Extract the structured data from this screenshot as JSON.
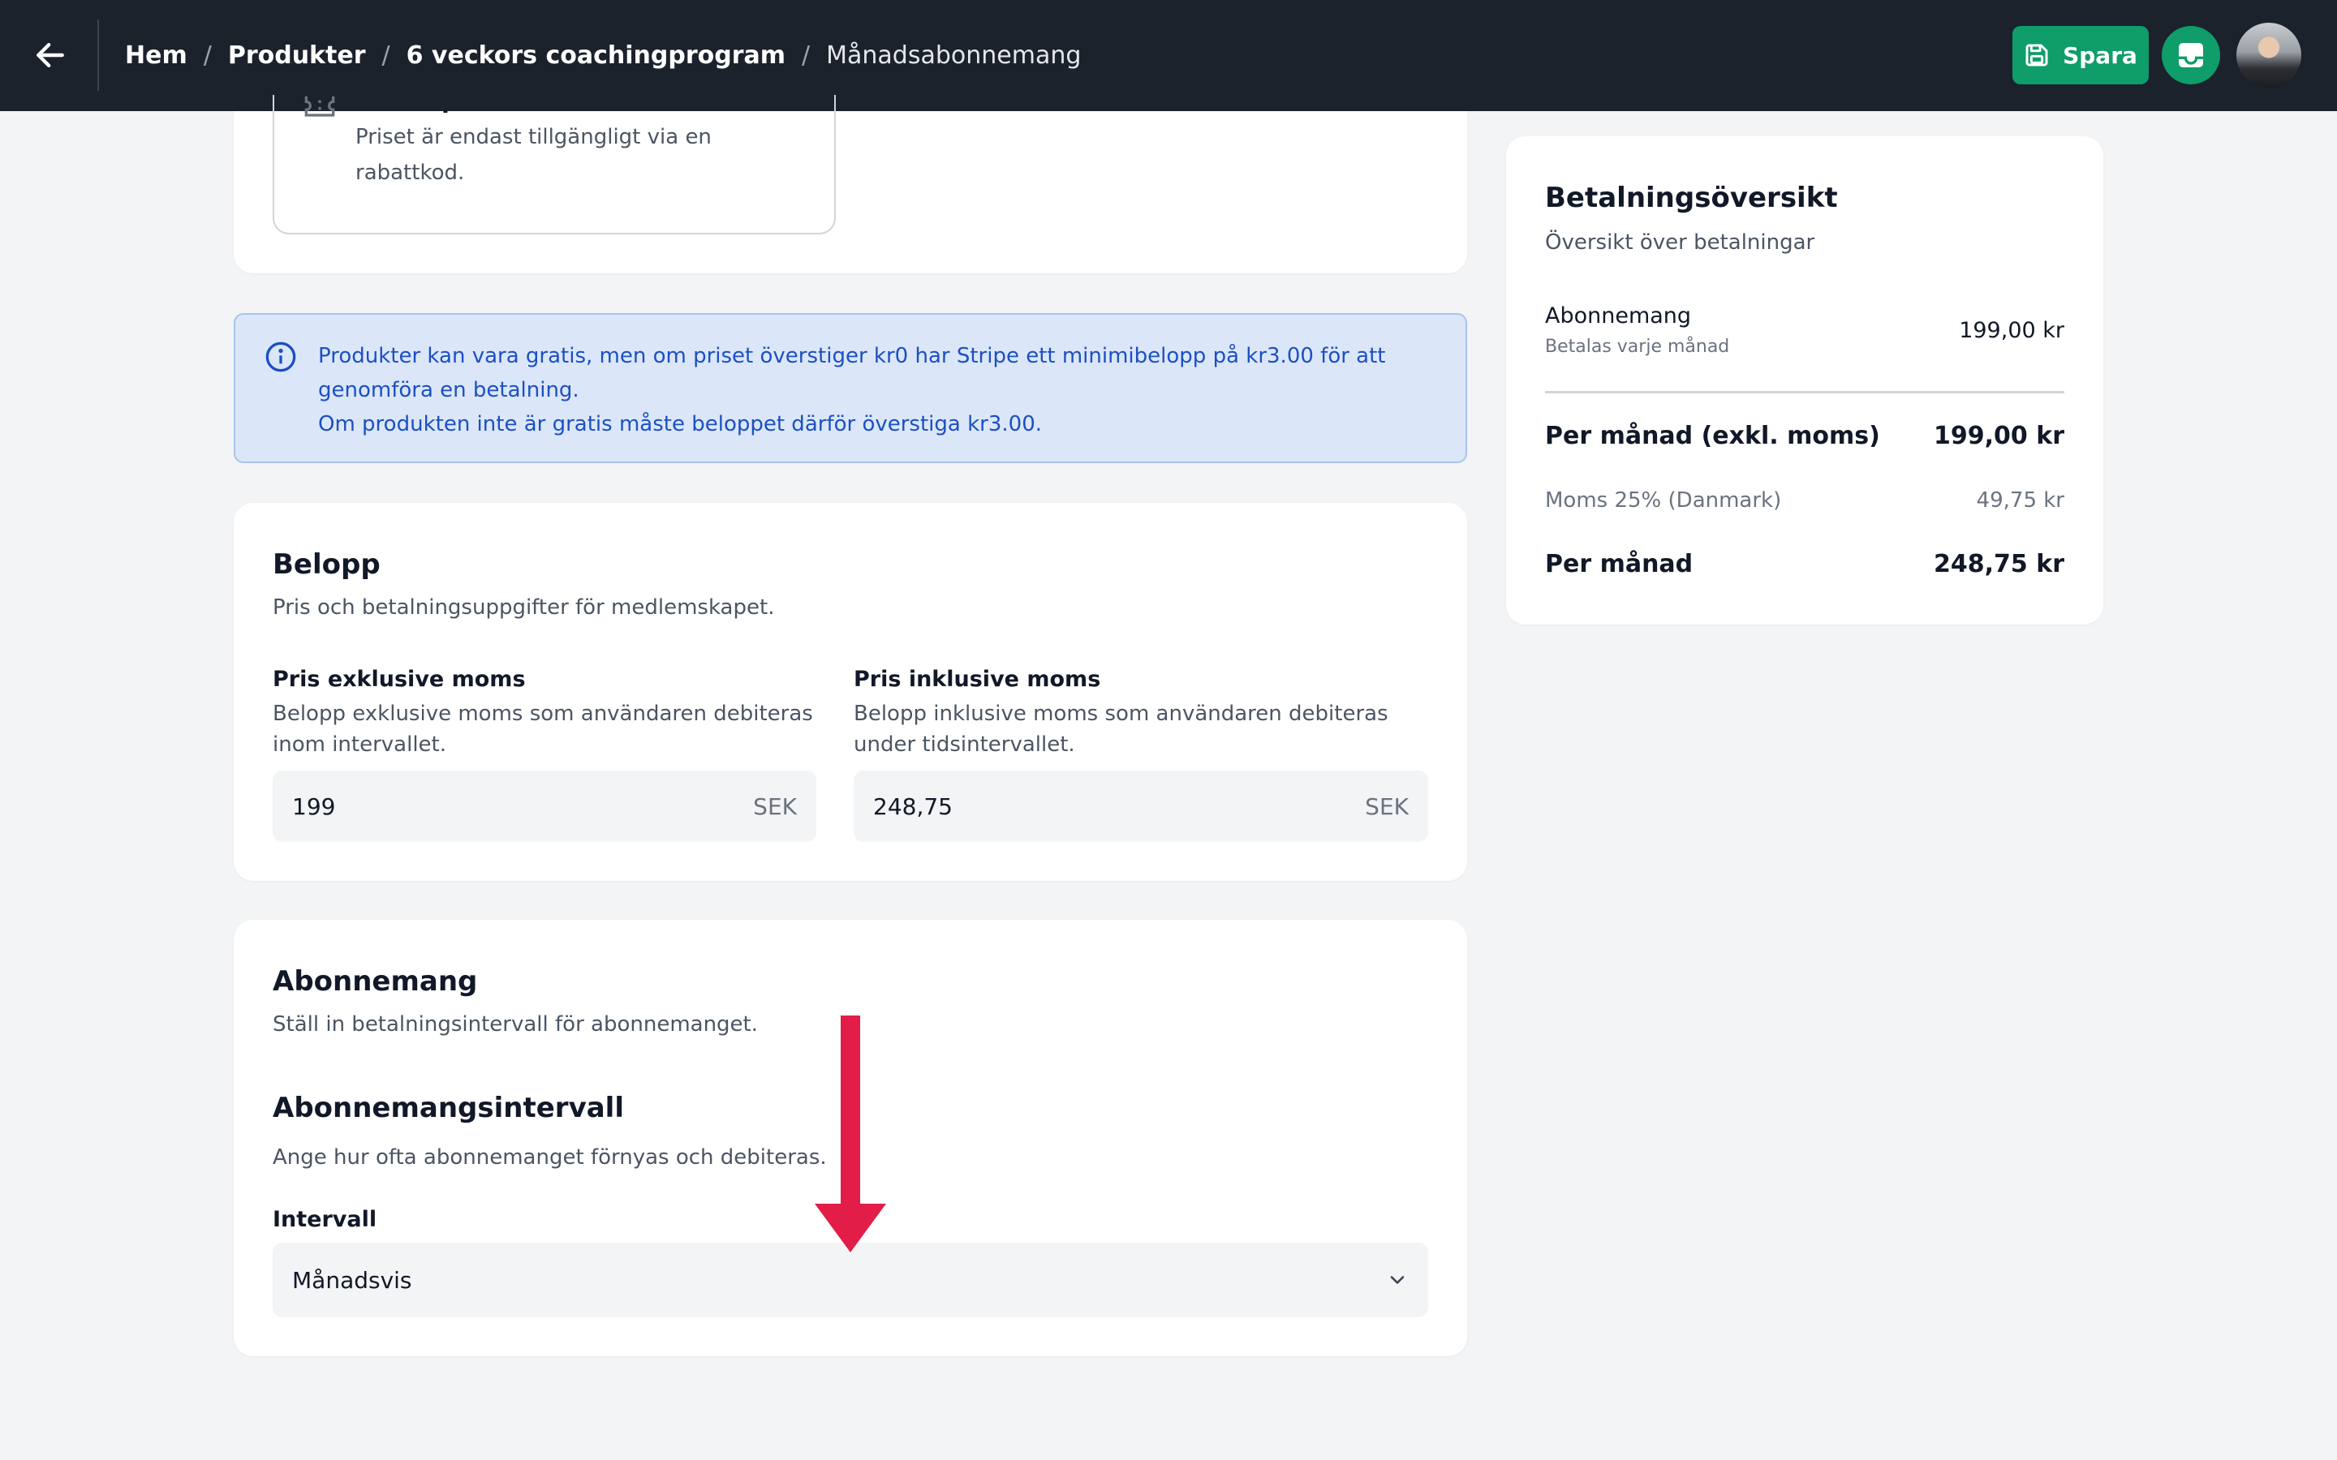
{
  "header": {
    "breadcrumb": {
      "home": "Hem",
      "products": "Produkter",
      "program": "6 veckors coachingprogram",
      "current": "Månadsabonnemang",
      "separator": "/"
    },
    "save_label": "Spara"
  },
  "rabatt_option": {
    "title": "Rabattpris",
    "description": "Priset är endast tillgängligt via en rabattkod."
  },
  "alert": {
    "line1": "Produkter kan vara gratis, men om priset överstiger kr0 har Stripe ett minimibelopp på kr3.00 för att genomföra en betalning.",
    "line2": "Om produkten inte är gratis måste beloppet därför överstiga kr3.00."
  },
  "belopp": {
    "title": "Belopp",
    "subtitle": "Pris och betalningsuppgifter för medlemskapet.",
    "excl": {
      "label": "Pris exklusive moms",
      "help": "Belopp exklusive moms som användaren debiteras inom intervallet.",
      "value": "199",
      "currency": "SEK"
    },
    "incl": {
      "label": "Pris inklusive moms",
      "help": "Belopp inklusive moms som användaren debiteras under tidsintervallet.",
      "value": "248,75",
      "currency": "SEK"
    }
  },
  "abonnemang": {
    "title": "Abonnemang",
    "subtitle": "Ställ in betalningsintervall för abonnemanget.",
    "interval_title": "Abonnemangsintervall",
    "interval_subtitle": "Ange hur ofta abonnemanget förnyas och debiteras.",
    "interval_label": "Intervall",
    "interval_value": "Månadsvis"
  },
  "payment_overview": {
    "title": "Betalningsöversikt",
    "subtitle": "Översikt över betalningar",
    "item_label": "Abonnemang",
    "item_sub": "Betalas varje månad",
    "item_value": "199,00 kr",
    "per_month_excl_label": "Per månad (exkl. moms)",
    "per_month_excl_value": "199,00 kr",
    "vat_label": "Moms 25% (Danmark)",
    "vat_value": "49,75 kr",
    "per_month_label": "Per månad",
    "per_month_value": "248,75 kr"
  },
  "colors": {
    "topbar": "#1b222c",
    "accent_green": "#0f9d6a",
    "info_blue": "#1d4fc4",
    "annotation_red": "#e11d48"
  },
  "icons": {
    "back": "arrow-left-icon",
    "save": "floppy-disk-icon",
    "inbox": "inbox-icon",
    "info": "info-circle-icon",
    "ticket": "ticket-icon",
    "chevron": "chevron-down-icon",
    "annotation": "arrow-down-icon"
  }
}
